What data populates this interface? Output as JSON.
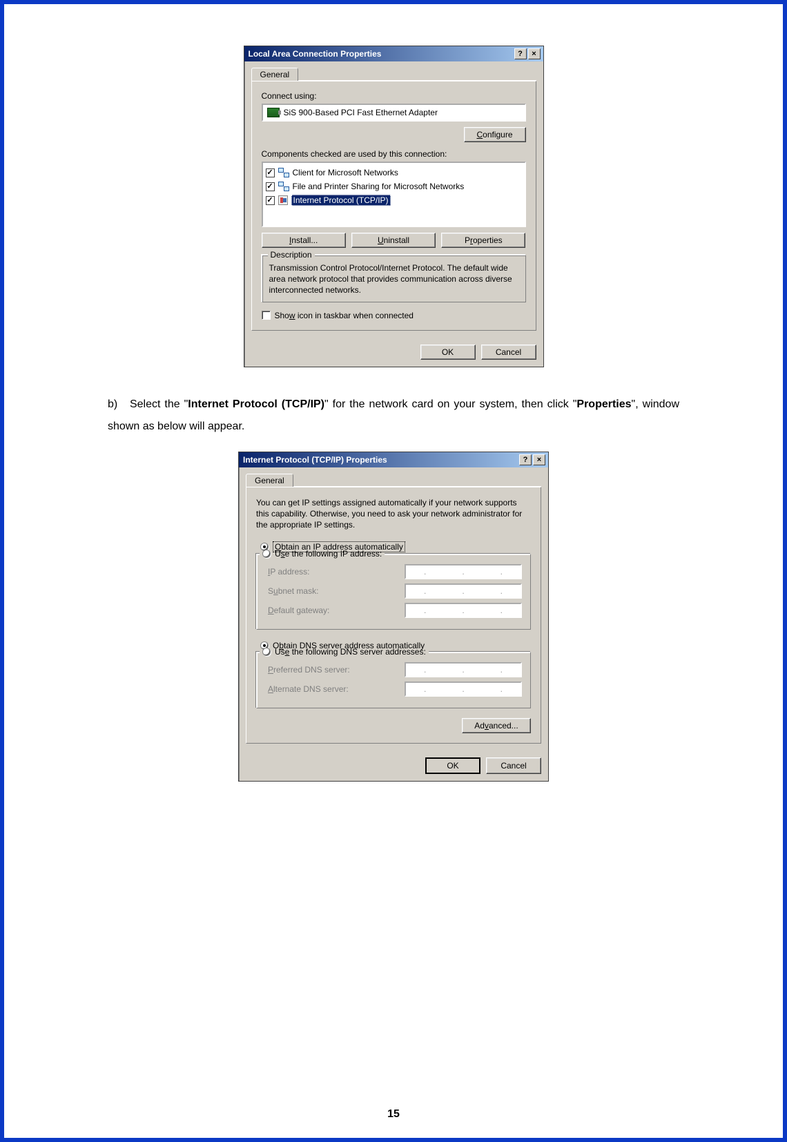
{
  "page_number": "15",
  "instruction": {
    "prefix": "b)",
    "text_before_bold1": "Select the \"",
    "bold1": "Internet Protocol (TCP/IP)",
    "text_mid": "\" for the network card on your system, then click \"",
    "bold2": "Properties",
    "text_after": "\", window shown as below will appear."
  },
  "dialog1": {
    "title": "Local Area Connection Properties",
    "help_btn": "?",
    "close_btn": "×",
    "tab": "General",
    "connect_using_label": "Connect using:",
    "adapter": "SiS 900-Based PCI Fast Ethernet Adapter",
    "configure_btn": "Configure",
    "components_label": "Components checked are used by this connection:",
    "items": [
      "Client for Microsoft Networks",
      "File and Printer Sharing for Microsoft Networks",
      "Internet Protocol (TCP/IP)"
    ],
    "install_btn": "Install...",
    "uninstall_btn": "Uninstall",
    "properties_btn": "Properties",
    "description_legend": "Description",
    "description_text": "Transmission Control Protocol/Internet Protocol. The default wide area network protocol that provides communication across diverse interconnected networks.",
    "show_icon": "Show icon in taskbar when connected",
    "ok_btn": "OK",
    "cancel_btn": "Cancel"
  },
  "dialog2": {
    "title": "Internet Protocol (TCP/IP) Properties",
    "help_btn": "?",
    "close_btn": "×",
    "tab": "General",
    "info_text": "You can get IP settings assigned automatically if your network supports this capability. Otherwise, you need to ask your network administrator for the appropriate IP settings.",
    "radio_obtain_ip": "Obtain an IP address automatically",
    "radio_use_ip": "Use the following IP address:",
    "ip_address_label": "IP address:",
    "subnet_label": "Subnet mask:",
    "gateway_label": "Default gateway:",
    "radio_obtain_dns": "Obtain DNS server address automatically",
    "radio_use_dns": "Use the following DNS server addresses:",
    "pref_dns_label": "Preferred DNS server:",
    "alt_dns_label": "Alternate DNS server:",
    "advanced_btn": "Advanced...",
    "ok_btn": "OK",
    "cancel_btn": "Cancel"
  }
}
